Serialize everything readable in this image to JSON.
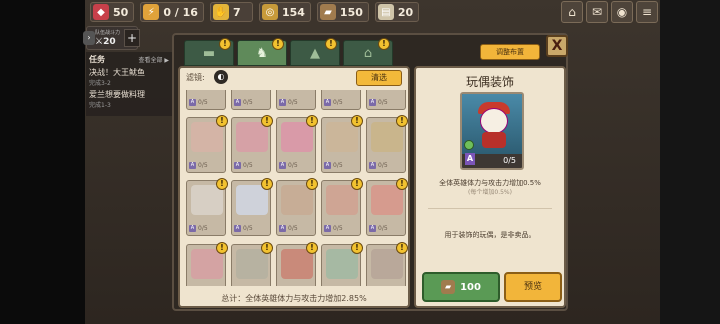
{
  "resources": [
    {
      "icon": "ruby-icon",
      "glyph": "◆",
      "color": "#c8404a",
      "value": "50"
    },
    {
      "icon": "lightning-icon",
      "glyph": "⚡",
      "color": "#e0a23a",
      "value": "0 / 16"
    },
    {
      "icon": "hand-icon",
      "glyph": "✋",
      "color": "#e3b43a",
      "value": "7"
    },
    {
      "icon": "gold-coin-icon",
      "glyph": "◎",
      "color": "#c79a3a",
      "value": "154"
    },
    {
      "icon": "wood-icon",
      "glyph": "▰",
      "color": "#a07b4e",
      "value": "150"
    },
    {
      "icon": "ticket-icon",
      "glyph": "▤",
      "color": "#cfc4a8",
      "value": "20"
    }
  ],
  "top_icons": [
    "home-icon",
    "mail-icon",
    "camera-icon",
    "menu-icon"
  ],
  "power": {
    "label": "队伍战斗力",
    "value": "⚔20"
  },
  "quest": {
    "title": "任务",
    "view_all": "查看全部 ▶",
    "items": [
      {
        "name": "决战！大王鱿鱼",
        "progress": "完成3-2"
      },
      {
        "name": "爱兰想要做料理",
        "progress": "完成1-3"
      }
    ]
  },
  "tabs": [
    {
      "name": "tab-furniture-1",
      "glyph": "▬",
      "active": false
    },
    {
      "name": "tab-chair",
      "glyph": "♞",
      "active": true
    },
    {
      "name": "tab-pot",
      "glyph": "▲",
      "active": false
    },
    {
      "name": "tab-house",
      "glyph": "⌂",
      "active": false
    }
  ],
  "adjust_label": "调整布置",
  "list": {
    "filter_label": "滤镜:",
    "clear_label": "清选",
    "total_text": "总计：全体英雄体力与攻击力增加2.85%"
  },
  "items": [
    {
      "count": "0/5",
      "color": "#c9a7a2",
      "alert": false
    },
    {
      "count": "0/5",
      "color": "#d2a8a8",
      "alert": false
    },
    {
      "count": "0/5",
      "color": "#b9aa94",
      "alert": false
    },
    {
      "count": "0/5",
      "color": "#d6a6b0",
      "alert": false
    },
    {
      "count": "0/5",
      "color": "#c2b49a",
      "alert": false
    },
    {
      "count": "0/5",
      "color": "#d4b4a6",
      "alert": true
    },
    {
      "count": "0/5",
      "color": "#d6a1a6",
      "alert": true
    },
    {
      "count": "0/5",
      "color": "#d99aa8",
      "alert": true
    },
    {
      "count": "0/5",
      "color": "#cbb69a",
      "alert": true
    },
    {
      "count": "0/5",
      "color": "#c9b58c",
      "alert": true
    },
    {
      "count": "0/5",
      "color": "#d7cfc4",
      "alert": true
    },
    {
      "count": "0/5",
      "color": "#cfd2da",
      "alert": true
    },
    {
      "count": "0/5",
      "color": "#c7ad96",
      "alert": true
    },
    {
      "count": "0/5",
      "color": "#cfa594",
      "alert": true
    },
    {
      "count": "0/5",
      "color": "#d69b8e",
      "alert": true
    },
    {
      "count": "0/5",
      "color": "#d4a3a3",
      "alert": true
    },
    {
      "count": "0/5",
      "color": "#b7b2a1",
      "alert": true
    },
    {
      "count": "0/5",
      "color": "#c98a7a",
      "alert": true
    },
    {
      "count": "0/5",
      "color": "#a6b9a3",
      "alert": true
    },
    {
      "count": "0/5",
      "color": "#b9a89a",
      "alert": true
    }
  ],
  "detail": {
    "title": "玩偶装饰",
    "rank": "A",
    "owned": "0/5",
    "effect": "全体英雄体力与攻击力增加0.5%",
    "effect_sub": "(每个增加0.5%)",
    "description": "用于装饰的玩偶，是非卖品。",
    "price": "100",
    "preview_label": "预览"
  },
  "close_label": "X"
}
